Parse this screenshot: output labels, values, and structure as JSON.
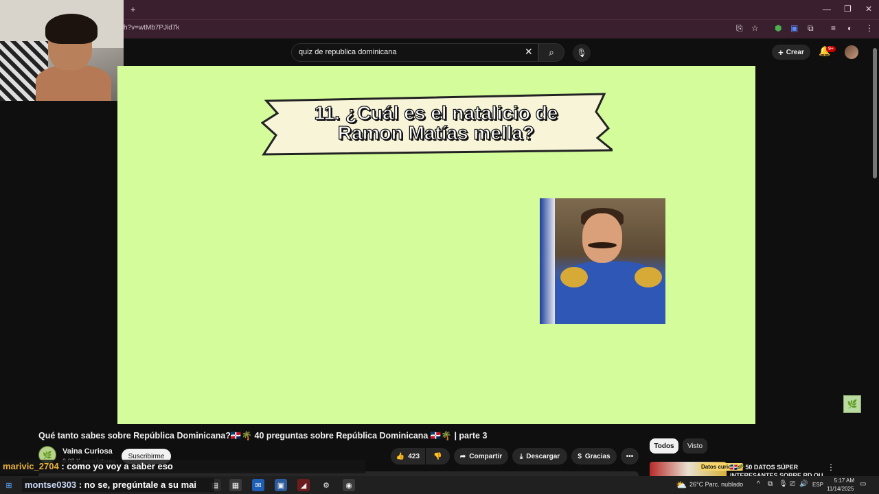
{
  "browser": {
    "url": "h?v=wtMb7PJid7k",
    "new_tab_glyph": "+",
    "icons": [
      "install-app-icon",
      "bookmark-star-icon",
      "extension-shield-icon",
      "translate-icon",
      "extensions-puzzle-icon",
      "media-icon",
      "profile-icon",
      "menu-kebab-icon"
    ],
    "window_controls": [
      "minimize-icon",
      "restore-icon",
      "close-icon"
    ]
  },
  "header": {
    "search_value": "quiz de republica dominicana",
    "create_label": "Crear",
    "notification_badge": "9+"
  },
  "video": {
    "question": "11. ¿Cuál es el natalicio de Ramon Matías mella?",
    "question_line1": "11. ¿Cuál es el natalicio de",
    "question_line2": "Ramon Matías mella?"
  },
  "watch": {
    "title": "Qué tanto sabes sobre República Dominicana?🇩🇴🌴 40 preguntas sobre República Dominicana 🇩🇴🌴 | parte 3",
    "channel_name": "Vaina Curiosa",
    "channel_subs": "9.08 K suscriptores",
    "subscribe_label": "Suscribirme",
    "likes": "423",
    "share_label": "Compartir",
    "download_label": "Descargar",
    "thanks_label": "Gracias"
  },
  "sidebar": {
    "chips": [
      "Todos",
      "Visto"
    ],
    "rec_title": "🇩🇴🌴50 DATOS SÚPER INTERESANTES SOBRE RD OU",
    "rec_thumb_label": "Datos curiosos"
  },
  "chat": [
    {
      "user": "marivic_2704",
      "message": ": como yo voy a saber eso"
    },
    {
      "user": "montse0303",
      "message": ": no se, pregúntale a su mai"
    }
  ],
  "taskbar": {
    "weather": "26°C  Parc. nublado",
    "language": "ESP",
    "time": "5:17 AM",
    "date": "11/14/2025"
  },
  "colors": {
    "video_bg": "#d4fc9a",
    "browser_chrome": "#3a1f2e",
    "yt_bg": "#0f0f0f",
    "chat_user1": "#e8b23a"
  }
}
